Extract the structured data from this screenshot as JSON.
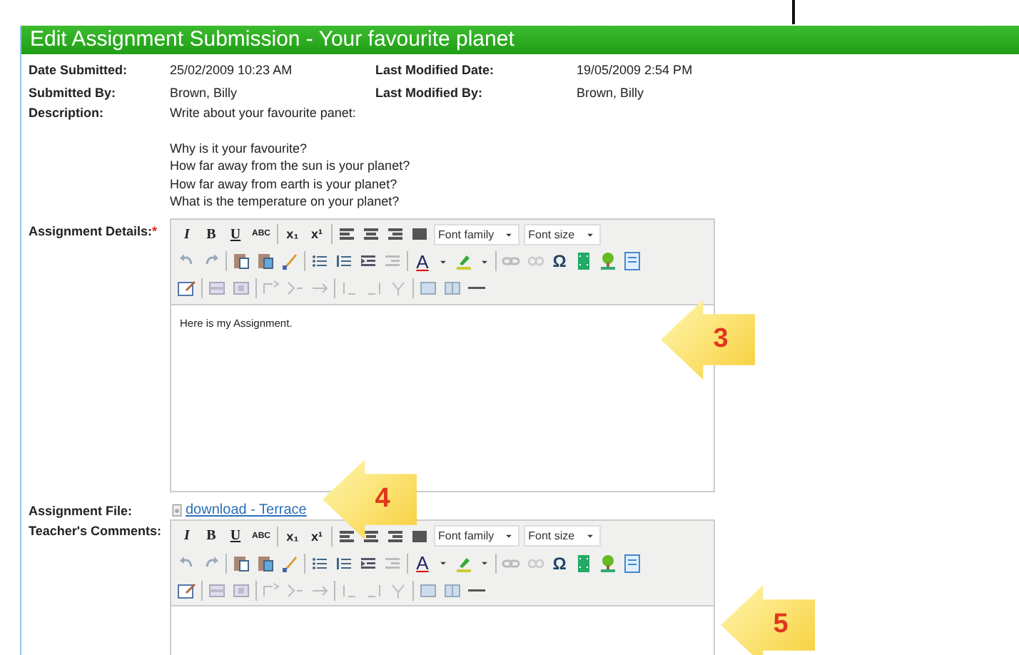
{
  "header": {
    "title": "Edit Assignment Submission - Your favourite planet"
  },
  "meta_rows": [
    {
      "items": [
        {
          "label": "Date Submitted:",
          "value": "25/02/2009 10:23 AM"
        },
        {
          "label": "Last Modified Date:",
          "value": "19/05/2009 2:54 PM"
        }
      ]
    },
    {
      "items": [
        {
          "label": "Submitted By:",
          "value": "Brown, Billy"
        },
        {
          "label": "Last Modified By:",
          "value": "Brown, Billy"
        }
      ]
    }
  ],
  "description": {
    "label": "Description:",
    "paragraphs": [
      [
        "Write about your favourite panet:"
      ],
      [
        "Why is it your favourite?",
        "How far away from the sun is your planet?",
        "How far away from earth is your planet?",
        "What is the temperature on your planet?"
      ]
    ]
  },
  "assignment_details": {
    "label": "Assignment Details:",
    "required_mark": "*",
    "editor": {
      "glyphs": [
        "I",
        "B",
        "U",
        "ABC",
        "x₁",
        "x¹",
        "A",
        "Ω"
      ],
      "selects": [
        "Font family",
        "Font size"
      ],
      "content": "Here is my Assignment."
    }
  },
  "assignment_file": {
    "label": "Assignment File:",
    "link": "download - Terrace"
  },
  "teachers_comments": {
    "label": "Teacher's Comments:",
    "editor": {
      "glyphs": [
        "I",
        "B",
        "U",
        "ABC",
        "x₁",
        "x¹",
        "A",
        "Ω"
      ],
      "selects": [
        "Font family",
        "Font size"
      ]
    }
  },
  "callouts": [
    {
      "number": "3"
    },
    {
      "number": "4"
    },
    {
      "number": "5"
    }
  ]
}
